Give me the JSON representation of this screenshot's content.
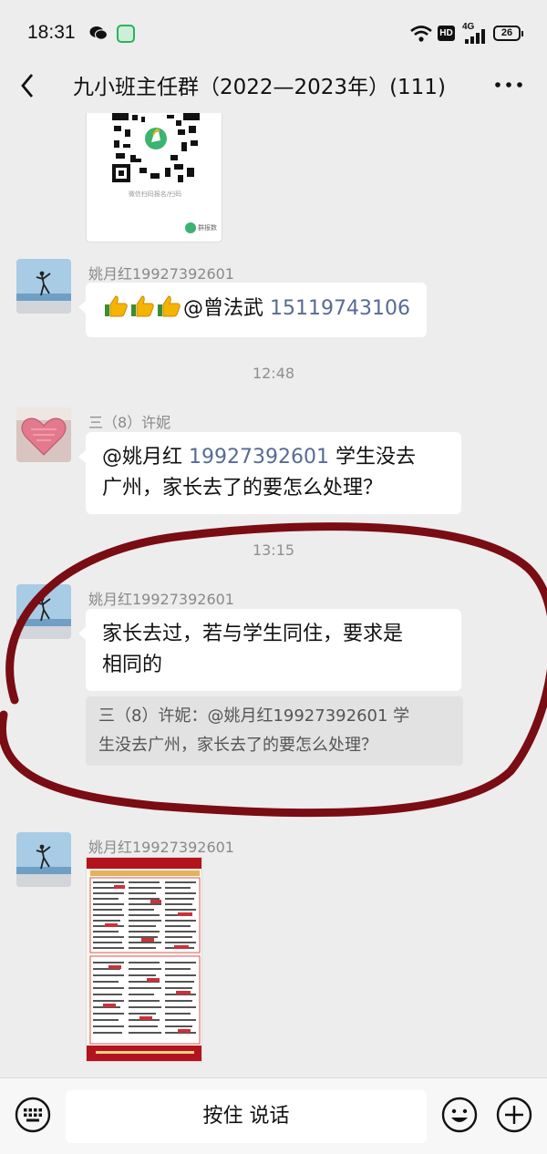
{
  "status_bar": {
    "time": "18:31",
    "hd": "HD",
    "network": "4G",
    "battery": "26"
  },
  "header": {
    "title": "九小班主任群（2022—2023年）(111)"
  },
  "qr_card": {
    "caption": "微信扫码报名/扫码",
    "brand": "群报数"
  },
  "messages": [
    {
      "sender": "姚月红19927392601",
      "mention": "@曾法武 ",
      "number": "15119743106"
    },
    {
      "time": "12:48"
    },
    {
      "sender": "三（8）许妮",
      "line1_pre": "@姚月红 ",
      "line1_num": "19927392601",
      "line1_post": "  学生没去",
      "line2": "广州，家长去了的要怎么处理？"
    },
    {
      "time": "13:15"
    },
    {
      "sender": "姚月红19927392601",
      "line1": "家长去过，若与学生同住，要求是",
      "line2": "相同的",
      "quote_line1": "三（8）许妮：@姚月红19927392601 学",
      "quote_line2": "生没去广州，家长去了的要怎么处理？"
    },
    {
      "sender": "姚月红19927392601"
    }
  ],
  "input_bar": {
    "voice_label": "按住 说话"
  }
}
